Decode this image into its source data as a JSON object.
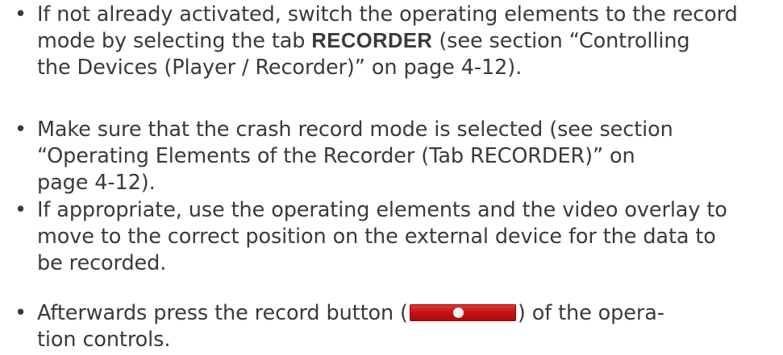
{
  "bullet_glyph": "•",
  "items": [
    {
      "lines": [
        "If not already activated, switch the operating elements to the record",
        "mode by selecting the tab ",
        "RECORDER",
        " (see section “Controlling",
        "the Devices (Player / Recorder)” on page 4-12)."
      ]
    },
    {
      "lines": [
        "Make sure that the crash record mode is selected (see section",
        "“Operating Elements of the Recorder (Tab RECORDER)” on",
        "page 4-12)."
      ]
    },
    {
      "lines": [
        "If appropriate, use the operating elements and the video overlay to",
        "move to the correct position on the external device for the data to",
        "be recorded."
      ]
    },
    {
      "lines": [
        "Afterwards press the record button (",
        ") of the opera-",
        "tion controls."
      ],
      "button_icon": "record-icon",
      "button_color": "#c81414"
    }
  ]
}
